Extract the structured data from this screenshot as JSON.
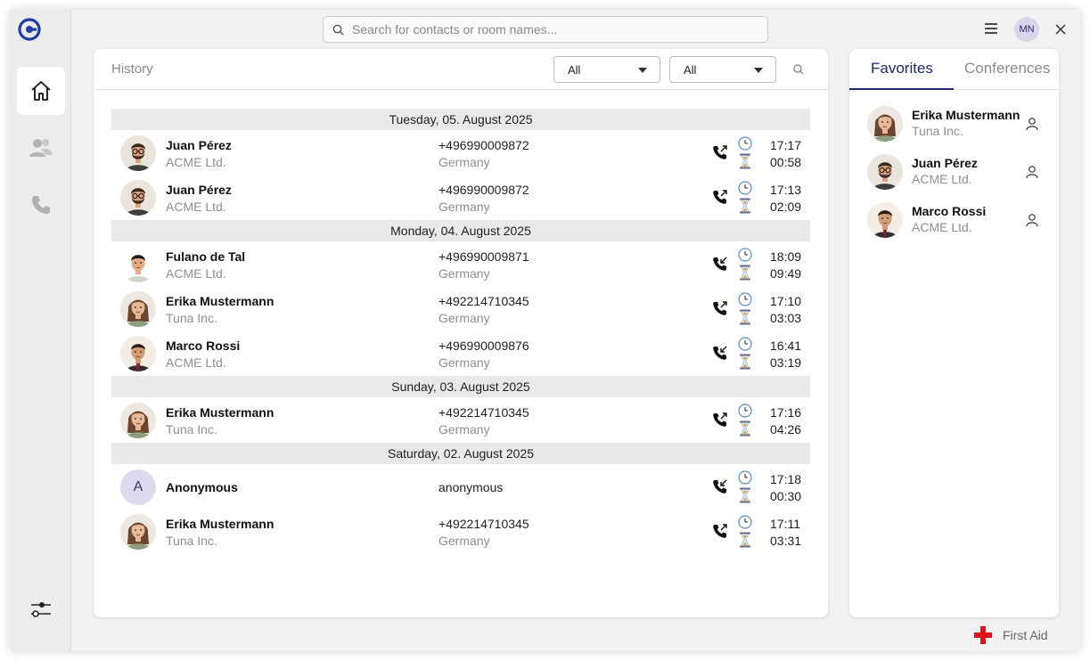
{
  "topbar": {
    "search_placeholder": "Search for contacts or room names...",
    "user_initials": "MN"
  },
  "nav": {
    "items": [
      "home-icon",
      "contacts-icon",
      "phone-icon"
    ],
    "bottom": "settings-sliders-icon"
  },
  "history": {
    "title": "History",
    "filter1": "All",
    "filter2": "All",
    "groups": [
      {
        "date": "Tuesday, 05. August 2025",
        "rows": [
          {
            "name": "Juan Pérez",
            "org": "ACME Ltd.",
            "number": "+496990009872",
            "country": "Germany",
            "direction": "outgoing",
            "time": "17:17",
            "duration": "00:58",
            "avatar": "juan"
          },
          {
            "name": "Juan Pérez",
            "org": "ACME Ltd.",
            "number": "+496990009872",
            "country": "Germany",
            "direction": "outgoing",
            "time": "17:13",
            "duration": "02:09",
            "avatar": "juan"
          }
        ]
      },
      {
        "date": "Monday, 04. August 2025",
        "rows": [
          {
            "name": "Fulano de Tal",
            "org": "ACME Ltd.",
            "number": "+496990009871",
            "country": "Germany",
            "direction": "incoming",
            "time": "18:09",
            "duration": "09:49",
            "avatar": "fulano"
          },
          {
            "name": "Erika Mustermann",
            "org": "Tuna Inc.",
            "number": "+492214710345",
            "country": "Germany",
            "direction": "outgoing",
            "time": "17:10",
            "duration": "03:03",
            "avatar": "erika"
          },
          {
            "name": "Marco Rossi",
            "org": "ACME Ltd.",
            "number": "+496990009876",
            "country": "Germany",
            "direction": "incoming",
            "time": "16:41",
            "duration": "03:19",
            "avatar": "marco"
          }
        ]
      },
      {
        "date": "Sunday, 03. August 2025",
        "rows": [
          {
            "name": "Erika Mustermann",
            "org": "Tuna Inc.",
            "number": "+492214710345",
            "country": "Germany",
            "direction": "outgoing",
            "time": "17:16",
            "duration": "04:26",
            "avatar": "erika"
          }
        ]
      },
      {
        "date": "Saturday, 02. August 2025",
        "rows": [
          {
            "name": "Anonymous",
            "org": "",
            "number": "anonymous",
            "country": "",
            "direction": "incoming",
            "time": "17:18",
            "duration": "00:30",
            "avatar": "letter",
            "letter": "A"
          },
          {
            "name": "Erika Mustermann",
            "org": "Tuna Inc.",
            "number": "+492214710345",
            "country": "Germany",
            "direction": "outgoing",
            "time": "17:11",
            "duration": "03:31",
            "avatar": "erika"
          }
        ]
      }
    ]
  },
  "favorites": {
    "tabs": [
      "Favorites",
      "Conferences"
    ],
    "active_tab": "Favorites",
    "items": [
      {
        "name": "Erika Mustermann",
        "org": "Tuna Inc.",
        "avatar": "erika"
      },
      {
        "name": "Juan Pérez",
        "org": "ACME Ltd.",
        "avatar": "juan"
      },
      {
        "name": "Marco Rossi",
        "org": "ACME Ltd.",
        "avatar": "marco"
      }
    ]
  },
  "footer": {
    "first_aid_label": "First Aid"
  },
  "colors": {
    "accent": "#1f2a6b",
    "logo": "#1f3da8",
    "first_aid_red": "#e0121a",
    "date_separator": "#e9e9e9"
  }
}
